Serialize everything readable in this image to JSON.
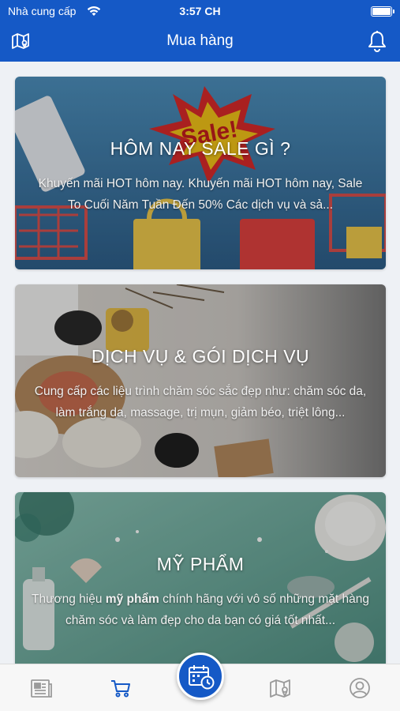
{
  "status_bar": {
    "carrier": "Nhà cung cấp",
    "time": "3:57 CH"
  },
  "header": {
    "title": "Mua hàng"
  },
  "cards": [
    {
      "title": "HÔM NAY SALE GÌ ?",
      "description": "Khuyến mãi HOT hôm nay. Khuyến mãi HOT hôm nay, Sale To Cuối Năm Tuần Đến 50% Các dịch vụ và sả...",
      "image_text": "Sale!"
    },
    {
      "title": "DỊCH VỤ & GÓI DỊCH VỤ",
      "description": "Cung cấp các liệu trình chăm sóc sắc đẹp như: chăm sóc da, làm trắng da, massage, trị mụn, giảm béo, triệt lông..."
    },
    {
      "title": "MỸ PHẨM",
      "description_before": "Thương hiệu ",
      "description_bold": "mỹ phẩm",
      "description_after": " chính hãng với vô số những mặt hàng chăm sóc và làm đẹp cho da bạn có giá tốt nhất..."
    }
  ],
  "tabbar": {
    "items": [
      "news-icon",
      "cart-icon",
      "calendar-clock-icon",
      "map-icon",
      "profile-icon"
    ],
    "active": "cart-icon"
  },
  "colors": {
    "brand": "#1559c6",
    "active_tab": "#1559c6",
    "inactive_tab": "#9a9a9a"
  }
}
